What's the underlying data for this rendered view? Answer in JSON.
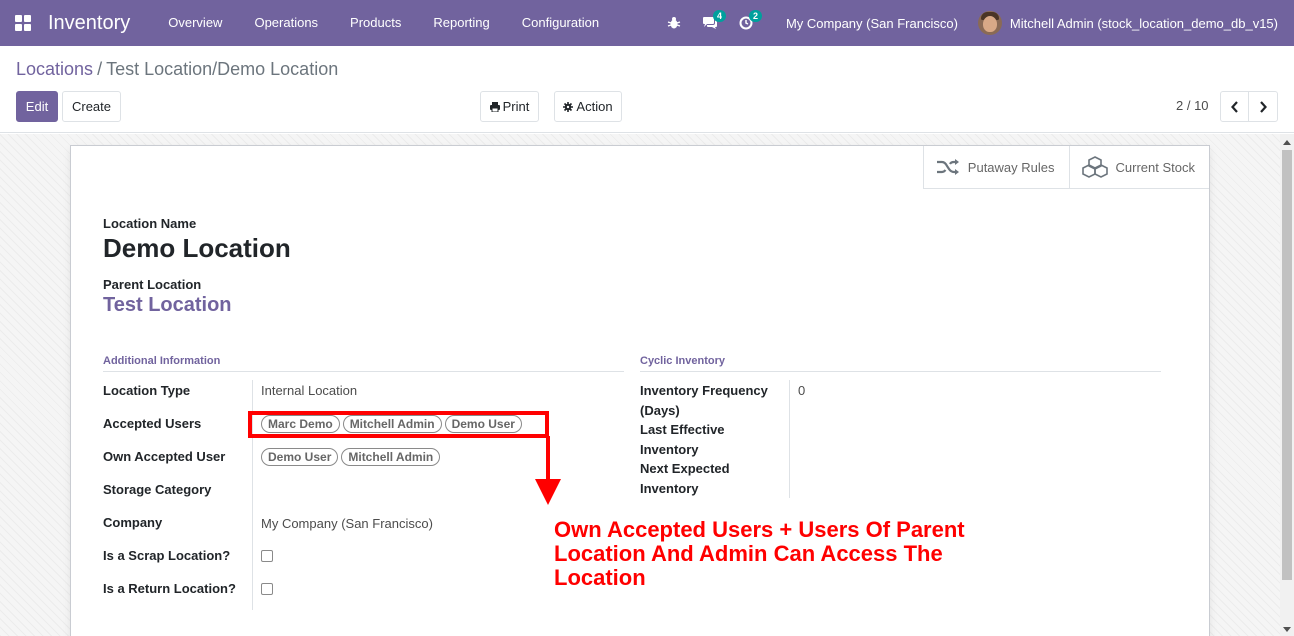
{
  "navbar": {
    "app_name": "Inventory",
    "menu": [
      "Overview",
      "Operations",
      "Products",
      "Reporting",
      "Configuration"
    ],
    "messages_count": "4",
    "activities_count": "2",
    "company": "My Company (San Francisco)",
    "user": "Mitchell Admin (stock_location_demo_db_v15)",
    "color": "#71639e"
  },
  "breadcrumb": {
    "parent": "Locations",
    "separator": "/",
    "current": "Test Location/Demo Location"
  },
  "actions": {
    "edit": "Edit",
    "create": "Create",
    "print": "Print",
    "action": "Action"
  },
  "pager": {
    "value": "2 / 10"
  },
  "smart_buttons": {
    "putaway": "Putaway Rules",
    "stock": "Current Stock"
  },
  "form": {
    "location_name_label": "Location Name",
    "location_name": "Demo Location",
    "parent_label": "Parent Location",
    "parent_value": "Test Location",
    "additional_info_title": "Additional Information",
    "cyclic_title": "Cyclic Inventory",
    "fields": {
      "location_type": {
        "label": "Location Type",
        "value": "Internal Location"
      },
      "accepted_users": {
        "label": "Accepted Users",
        "tags": [
          "Marc Demo",
          "Mitchell Admin",
          "Demo User"
        ]
      },
      "own_accepted_user": {
        "label": "Own Accepted User",
        "tags": [
          "Demo User",
          "Mitchell Admin"
        ]
      },
      "storage_category": {
        "label": "Storage Category",
        "value": ""
      },
      "company": {
        "label": "Company",
        "value": "My Company (San Francisco)"
      },
      "is_scrap": {
        "label": "Is a Scrap Location?",
        "checked": false
      },
      "is_return": {
        "label": "Is a Return Location?",
        "checked": false
      }
    },
    "cyclic": {
      "frequency_label_1": "Inventory Frequency",
      "frequency_label_2": "(Days)",
      "frequency_value": "0",
      "last_label_1": "Last Effective",
      "last_label_2": "Inventory",
      "next_label_1": "Next Expected",
      "next_label_2": "Inventory"
    }
  },
  "annotation": {
    "line1": "Own Accepted Users + Users Of Parent",
    "line2": "Location And Admin Can Access The",
    "line3": "Location",
    "color": "#ff0000"
  }
}
